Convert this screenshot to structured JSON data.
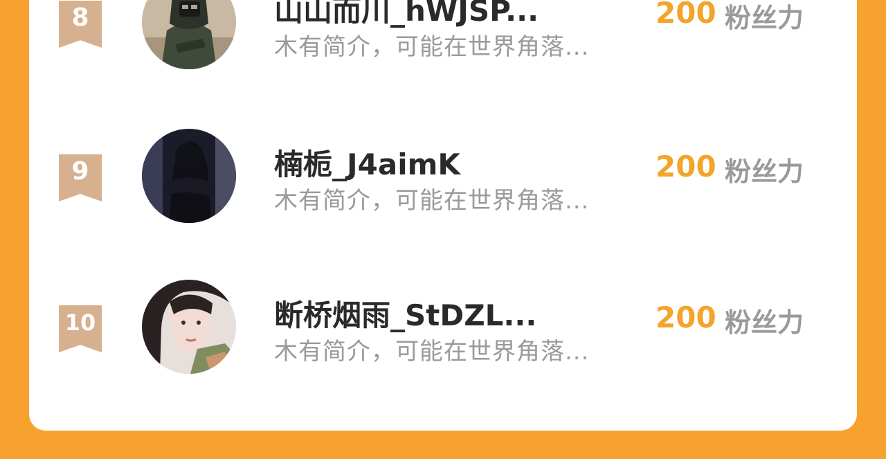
{
  "leaderboard": {
    "entries": [
      {
        "rank": "8",
        "name": "山山而川_hWJSP...",
        "bio": "木有简介，可能在世界角落...",
        "score": "200",
        "score_label": "粉丝力",
        "avatar": "avatar-hooded-figure-icon"
      },
      {
        "rank": "9",
        "name": "楠栀_J4aimK",
        "bio": "木有简介，可能在世界角落...",
        "score": "200",
        "score_label": "粉丝力",
        "avatar": "avatar-dark-silhouette-icon"
      },
      {
        "rank": "10",
        "name": "断桥烟雨_StDZL...",
        "bio": "木有简介，可能在世界角落...",
        "score": "200",
        "score_label": "粉丝力",
        "avatar": "avatar-girl-portrait-icon"
      }
    ]
  },
  "colors": {
    "background": "#f7a12e",
    "card": "#ffffff",
    "rank_badge": "#d6b08f",
    "score": "#f2a42b",
    "muted_text": "#9a9a9a",
    "name_text": "#2a2a2a"
  }
}
